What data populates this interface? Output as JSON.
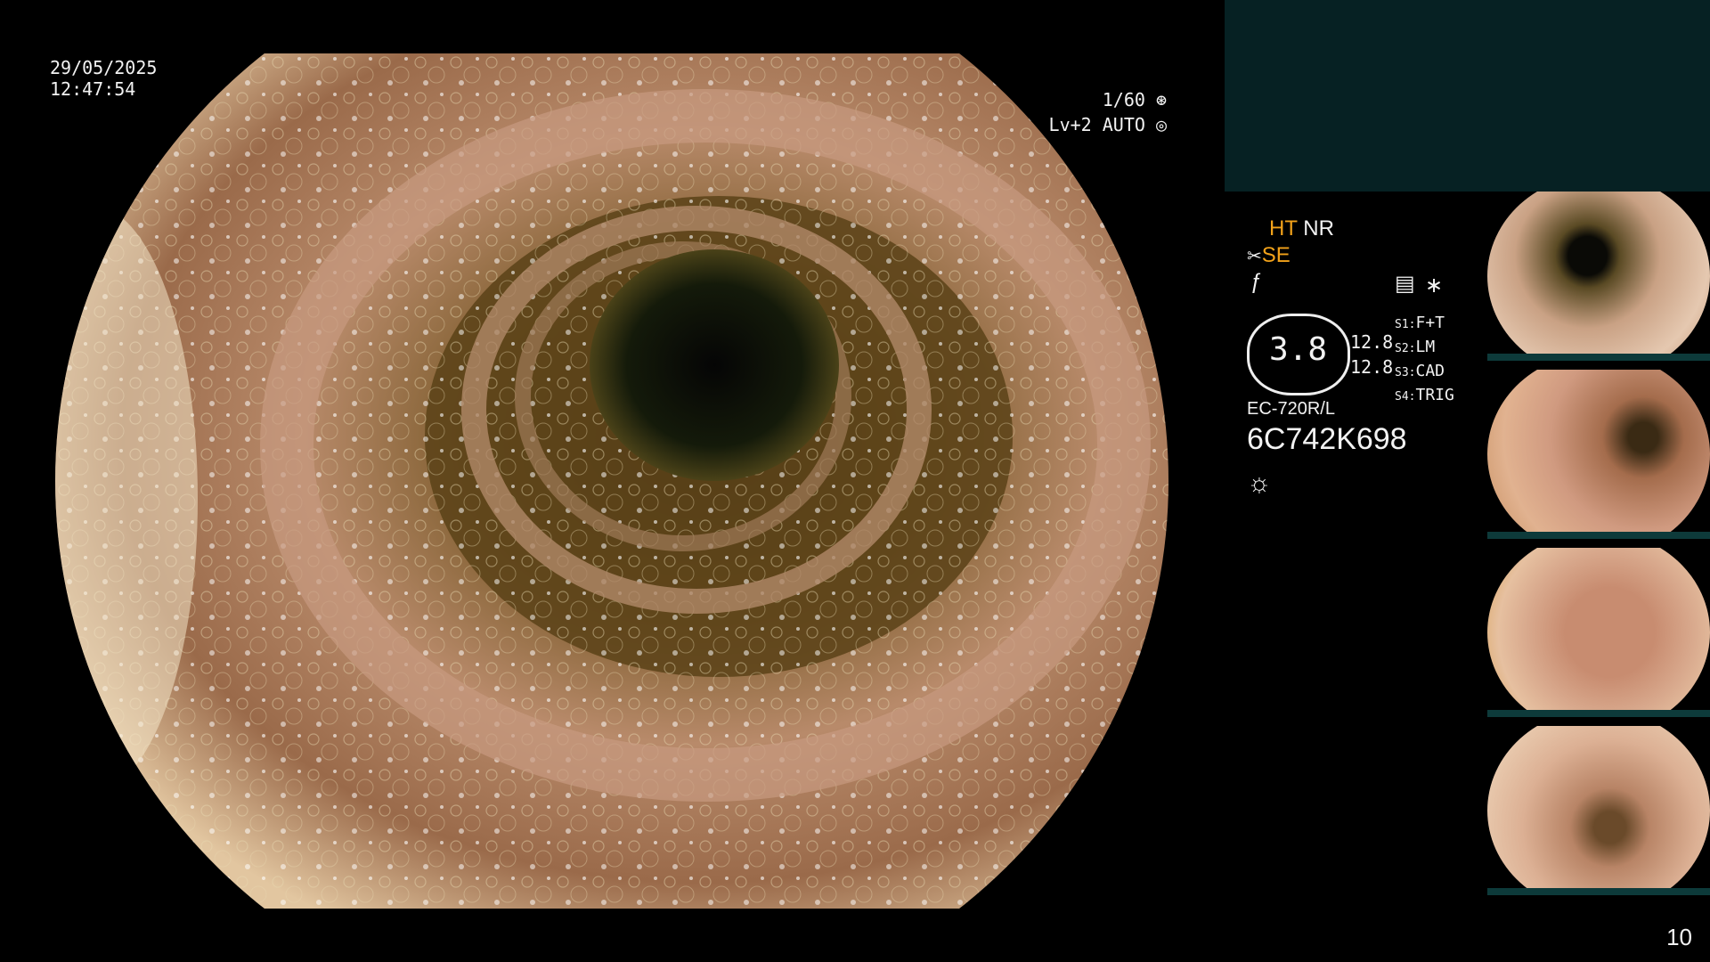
{
  "overlay": {
    "date": "29/05/2025",
    "time": "12:47:54",
    "shutter": "1/60",
    "exposure": "Lv+2 AUTO"
  },
  "settings": {
    "ht": "HT",
    "nr": "NR",
    "se": "SE",
    "gauge_value": "3.8",
    "readout_1": "12.8",
    "readout_2": "12.8",
    "modes": [
      {
        "key": "S1:",
        "value": "F+T"
      },
      {
        "key": "S2:",
        "value": "LM"
      },
      {
        "key": "S3:",
        "value": "CAD"
      },
      {
        "key": "S4:",
        "value": "TRIG"
      }
    ],
    "scope_model": "EC-720R/L",
    "serial": "6C742K698"
  },
  "icons": {
    "shutter": "aperture-icon",
    "auto": "auto-iris-icon",
    "scissor": "scissor-icon",
    "f_symbol": "f-icon",
    "memo": "memo-icon",
    "asterisk": "asterisk-icon",
    "light": "sun-icon"
  },
  "thumbnail_count": 4,
  "page_number": "10",
  "colors": {
    "accent_orange": "#f2a21a",
    "panel_teal": "#062123"
  }
}
